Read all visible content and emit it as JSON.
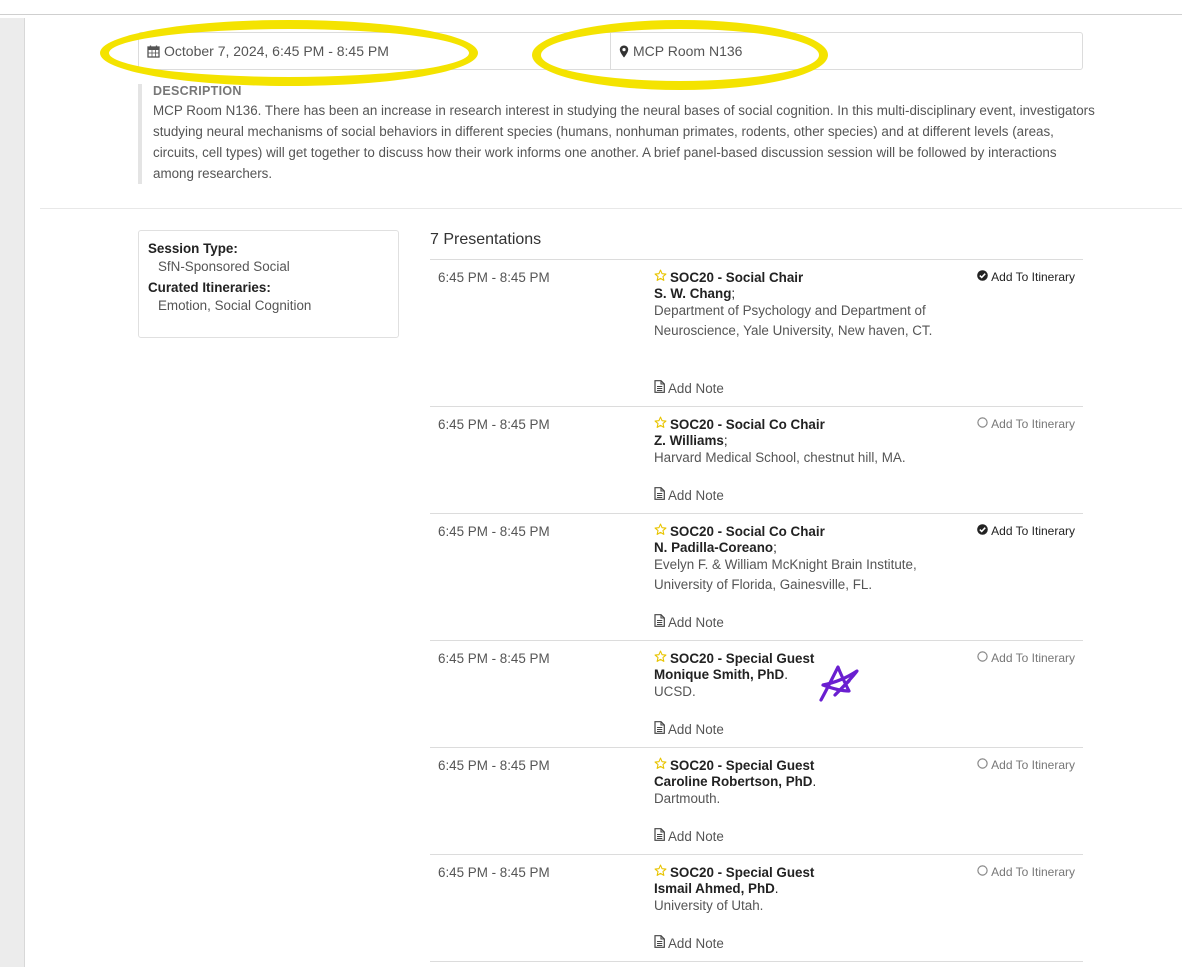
{
  "event": {
    "datetime": "October 7, 2024, 6:45 PM - 8:45 PM",
    "location": "MCP Room N136"
  },
  "description": {
    "heading": "DESCRIPTION",
    "text": "MCP Room N136. There has been an increase in research interest in studying the neural bases of social cognition. In this multi-disciplinary event, investigators studying neural mechanisms of social behaviors in different species (humans, nonhuman primates, rodents, other species) and at different levels (areas, circuits, cell types) will get together to discuss how their work informs one another. A brief panel-based discussion session will be followed by interactions among researchers."
  },
  "session": {
    "type_label": "Session Type:",
    "type_value": "SfN-Sponsored Social",
    "itineraries_label": "Curated Itineraries:",
    "itineraries_value": "Emotion, Social Cognition"
  },
  "presentations": {
    "heading": "7 Presentations",
    "add_note_label": "Add Note",
    "add_itinerary_label": "Add To Itinerary",
    "items": [
      {
        "time": "6:45 PM - 8:45 PM",
        "title": "SOC20 - Social Chair",
        "speaker": "S. W. Chang",
        "sep": ";",
        "affiliation": "Department of Psychology and Department of Neuroscience, Yale University, New haven, CT.",
        "in_itinerary": true
      },
      {
        "time": "6:45 PM - 8:45 PM",
        "title": "SOC20 - Social Co Chair",
        "speaker": "Z. Williams",
        "sep": ";",
        "affiliation": "Harvard Medical School, chestnut hill, MA.",
        "in_itinerary": false
      },
      {
        "time": "6:45 PM - 8:45 PM",
        "title": "SOC20 - Social Co Chair",
        "speaker": "N. Padilla-Coreano",
        "sep": ";",
        "affiliation": "Evelyn F. & William McKnight Brain Institute, University of Florida, Gainesville, FL.",
        "in_itinerary": true
      },
      {
        "time": "6:45 PM - 8:45 PM",
        "title": "SOC20 - Special Guest",
        "speaker": "Monique Smith, PhD",
        "sep": ".",
        "affiliation": "UCSD.",
        "in_itinerary": false
      },
      {
        "time": "6:45 PM - 8:45 PM",
        "title": "SOC20 - Special Guest",
        "speaker": "Caroline Robertson, PhD",
        "sep": ".",
        "affiliation": "Dartmouth.",
        "in_itinerary": false
      },
      {
        "time": "6:45 PM - 8:45 PM",
        "title": "SOC20 - Special Guest",
        "speaker": "Ismail Ahmed, PhD",
        "sep": ".",
        "affiliation": "University of Utah.",
        "in_itinerary": false
      }
    ]
  },
  "colors": {
    "highlight": "#f4e300",
    "star": "#e8c400",
    "scribble": "#6a1fd0"
  }
}
